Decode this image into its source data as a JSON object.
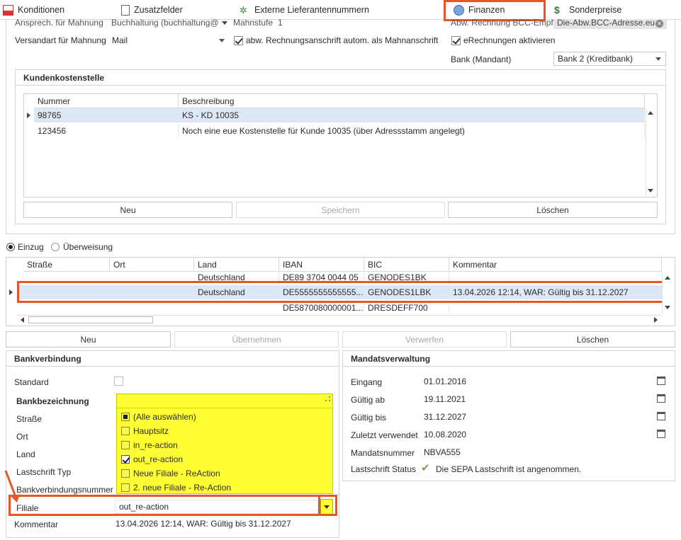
{
  "tabs": [
    {
      "label": "Konditionen",
      "icon": "pdf-icon"
    },
    {
      "label": "Zusatzfelder",
      "icon": "document-icon"
    },
    {
      "label": "Externe Lieferantennummern",
      "icon": "gears-icon"
    },
    {
      "label": "Finanzen",
      "icon": "finance-icon"
    },
    {
      "label": "Sonderpreise",
      "icon": "money-bag-icon"
    }
  ],
  "top": {
    "ansprech_label": "Ansprech. für Mahnung",
    "ansprech_value": "Buchhaltung (buchhaltung@",
    "mahnstufe_label": "Mahnstufe",
    "mahnstufe_value": "1",
    "abw_bcc_label": "Abw. Rechnung BCC-Empf.",
    "abw_bcc_value": "Die-Abw.BCC-Adresse.eu",
    "versandart_label": "Versandart für Mahnung",
    "versandart_value": "Mail",
    "abw_rechnung_label": "abw. Rechnungsanschrift autom. als Mahnanschrift",
    "erechnung_label": "eRechnungen aktivieren",
    "bank_label": "Bank (Mandant)",
    "bank_value": "Bank 2 (Kreditbank)"
  },
  "kostenstelle": {
    "title": "Kundenkostenstelle",
    "headers": [
      "Nummer",
      "Beschreibung"
    ],
    "rows": [
      {
        "nummer": "98765",
        "beschreibung": "KS - KD 10035"
      },
      {
        "nummer": "123456",
        "beschreibung": "Noch eine eue Kostenstelle für Kunde 10035 (über Adressstamm angelegt)"
      }
    ],
    "buttons": {
      "neu": "Neu",
      "speichern": "Speichern",
      "loeschen": "Löschen"
    }
  },
  "zahlungsart": {
    "einzug": "Einzug",
    "ueberweisung": "Überweisung"
  },
  "bankgrid": {
    "headers": [
      "Straße",
      "Ort",
      "Land",
      "IBAN",
      "BIC",
      "Kommentar"
    ],
    "rows": [
      {
        "strasse": "",
        "ort": "",
        "land": "Deutschland",
        "iban": "DE89 3704 0044 05",
        "bic": "GENODES1BK",
        "kommentar": ""
      },
      {
        "strasse": "",
        "ort": "",
        "land": "Deutschland",
        "iban": "DE5555555555555...",
        "bic": "GENODES1LBK",
        "kommentar": "13.04.2026 12:14, WAR: Gültig bis 31.12.2027"
      },
      {
        "strasse": "",
        "ort": "",
        "land": "",
        "iban": "DE5870080000001...",
        "bic": "DRESDEFF700",
        "kommentar": ""
      }
    ],
    "buttons": {
      "neu": "Neu",
      "uebernehmen": "Übernehmen",
      "verwerfen": "Verwerfen",
      "loeschen": "Löschen"
    }
  },
  "bankverbindung": {
    "title": "Bankverbindung",
    "standard_label": "Standard",
    "bankbezeichnung_label": "Bankbezeichnung",
    "strasse_label": "Straße",
    "ort_label": "Ort",
    "land_label": "Land",
    "lastschrift_typ_label": "Lastschrift Typ",
    "bankverbindungsnummer_label": "Bankverbindungsnummer",
    "filiale_label": "Filiale",
    "filiale_value": "out_re-action",
    "kommentar_label": "Kommentar",
    "kommentar_value": "13.04.2026 12:14, WAR: Gültig bis 31.12.2027"
  },
  "filiale_dropdown": {
    "items": [
      {
        "label": "(Alle auswählen)",
        "state": "partial"
      },
      {
        "label": "Hauptsitz",
        "state": "off"
      },
      {
        "label": "in_re-action",
        "state": "off"
      },
      {
        "label": "out_re-action",
        "state": "on"
      },
      {
        "label": "Neue Filiale - ReAction",
        "state": "off"
      },
      {
        "label": "2. neue Filiale - Re-Action",
        "state": "off"
      }
    ]
  },
  "mandat": {
    "title": "Mandatsverwaltung",
    "eingang_label": "Eingang",
    "eingang_value": "01.01.2016",
    "gueltig_ab_label": "Gültig ab",
    "gueltig_ab_value": "19.11.2021",
    "gueltig_bis_label": "Gültig bis",
    "gueltig_bis_value": "31.12.2027",
    "zuletzt_label": "Zuletzt verwendet",
    "zuletzt_value": "10.08.2020",
    "mandatsnummer_label": "Mandatsnummer",
    "mandatsnummer_value": "NBVA555",
    "status_label": "Lastschrift Status",
    "status_value": "Die SEPA Lastschrift ist angenommen."
  },
  "colors": {
    "highlight": "#e8552a",
    "selection": "#dce8f6",
    "dropdown": "#ffff33"
  }
}
